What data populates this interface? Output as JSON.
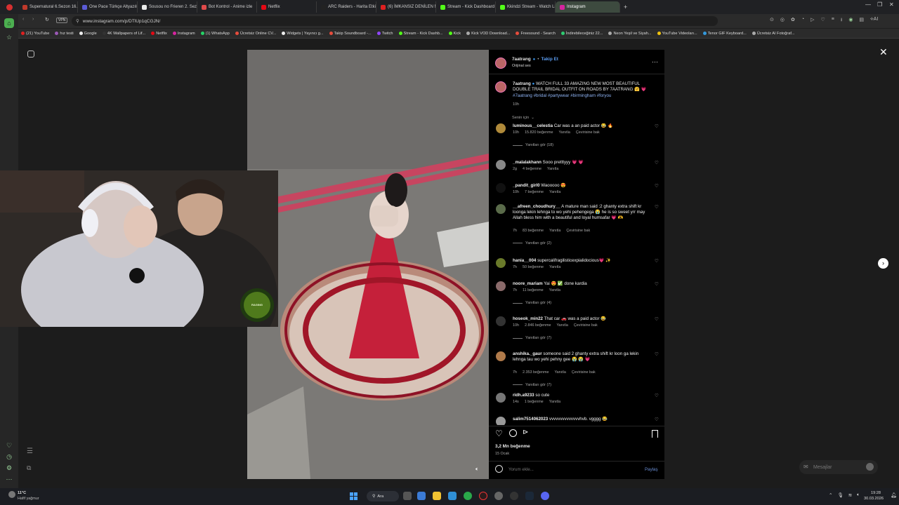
{
  "browser": {
    "tabs": [
      {
        "title": "Supernatural 6.Sezon 16.B",
        "color": "#c0392b"
      },
      {
        "title": "One Pace Türkçe Altyazılı",
        "color": "#5b5bd6"
      },
      {
        "title": "Sousou no Frieren 2. Sezo",
        "color": "#eaeaea"
      },
      {
        "title": "Bot Kontrol - Anime izle",
        "color": "#e04a4a"
      },
      {
        "title": "Netflix",
        "color": "#e50914"
      },
      {
        "title": "ARC Raiders - Harita Etkin",
        "color": "#222"
      },
      {
        "title": "(6) İMKANSIZ DENİLEN M",
        "color": "#e02020"
      },
      {
        "title": "Stream - Kick Dashboard",
        "color": "#53fc18"
      },
      {
        "title": "Kkindzi Stream - Watch Li",
        "color": "#53fc18"
      },
      {
        "title": "Instagram",
        "color": "#d6249f"
      }
    ],
    "url": "www.instagram.com/p/DTlUp1qCGJN/",
    "vpn_label": "VPN",
    "bookmarks": [
      {
        "label": "(21) YouTube",
        "color": "#e02020"
      },
      {
        "label": "hız testi",
        "color": "#9b59b6"
      },
      {
        "label": "Google",
        "color": "#eee"
      },
      {
        "label": "4K Wallpapers of Lif...",
        "color": "#333"
      },
      {
        "label": "Netflix",
        "color": "#e50914"
      },
      {
        "label": "Instagram",
        "color": "#d6249f"
      },
      {
        "label": "(1) WhatsApp",
        "color": "#25d366"
      },
      {
        "label": "Ücretsiz Online CV...",
        "color": "#e74c3c"
      },
      {
        "label": "Widgets | Yayıncı g...",
        "color": "#eee"
      },
      {
        "label": "Takip Soundboard -...",
        "color": "#e74c3c"
      },
      {
        "label": "Twitch",
        "color": "#9146ff"
      },
      {
        "label": "Stream - Kick Dashb...",
        "color": "#53fc18"
      },
      {
        "label": "Kick",
        "color": "#53fc18"
      },
      {
        "label": "Kick VOD Download...",
        "color": "#aaa"
      },
      {
        "label": "Freesound - Search",
        "color": "#e74c3c"
      },
      {
        "label": "İndirebileceğiniz 22...",
        "color": "#2ecc71"
      },
      {
        "label": "Neon Yeşil ve Siyah...",
        "color": "#aaa"
      },
      {
        "label": "YouTube Videoları...",
        "color": "#f1c40f"
      },
      {
        "label": "Tenor GIF Keyboard...",
        "color": "#3498db"
      },
      {
        "label": "Ücretsiz AI Fotoğraf...",
        "color": "#aaa"
      }
    ]
  },
  "post": {
    "author": "7aatrang",
    "follow_label": "Takip Et",
    "audio": "Orijinal ses",
    "caption_user": "7aatrang",
    "caption_text": "WATCH FULL 33 AMAZING NEW MOST BEAUTIFUL DOUBLE TRAIL BRIDAL OUTFIT ON ROADS BY 7AATRANG",
    "caption_tags": "#7aatrang #bridal #partywear #birmingham #foryou",
    "caption_time": "10h",
    "sort_label": "Senin için",
    "likes": "3,2 Mn beğenme",
    "date": "15 Ocak",
    "comment_placeholder": "Yorum ekle...",
    "share_label": "Paylaş"
  },
  "comments": [
    {
      "user": "luminous__celestia",
      "text": "Car was a an paid actor 😂 🔥",
      "meta": [
        "10h",
        "15.820 beğenme",
        "Yanıtla",
        "Çevirisine bak"
      ],
      "replies": "Yanıtları gör (18)",
      "avatar": "#b08a3a"
    },
    {
      "user": "_malalakhann",
      "text": "Sooo pretttyyy 💗 💗",
      "meta": [
        "2g",
        "4 beğenme",
        "Yanıtla"
      ],
      "replies": "",
      "avatar": "#888"
    },
    {
      "user": "_pandit_girl0",
      "text": "Waooooo 😍",
      "meta": [
        "10h",
        "7 beğenme",
        "Yanıtla"
      ],
      "replies": "",
      "avatar": "#111"
    },
    {
      "user": "__afreen_choudhury__",
      "text": "A mature man said :2 ghanty extra shift kr loonga lekin lehnga to wo yehi pehengega 😭 he is so sweet yrr may Allah bless him with a beautiful and loyal humsafar 💗 🫶",
      "meta": [
        "7h",
        "83 beğenme",
        "Yanıtla",
        "Çevirisine bak"
      ],
      "replies": "Yanıtları gör (2)",
      "avatar": "#5a6b4a"
    },
    {
      "user": "hania__004",
      "text": "supercalifragilisticexpialidocious💗 ✨",
      "meta": [
        "7h",
        "50 beğenme",
        "Yanıtla"
      ],
      "replies": "",
      "avatar": "#6a7a2a"
    },
    {
      "user": "noore_mariam",
      "text": "Yai 😍 ✅ done kardia",
      "meta": [
        "7h",
        "11 beğenme",
        "Yanıtla"
      ],
      "replies": "Yanıtları gör (4)",
      "avatar": "#8a6a6a"
    },
    {
      "user": "hoseok_min22",
      "text": "That car 🚗 was a paid actor 😂",
      "meta": [
        "10h",
        "2.846 beğenme",
        "Yanıtla",
        "Çevirisine bak"
      ],
      "replies": "Yanıtları gör (7)",
      "avatar": "#333"
    },
    {
      "user": "anshika._gaur",
      "text": "someone said 2 ghanty extra shift kr loon ga lekin lehnga tau wo yehi pehny gee 😭 😭 💗",
      "meta": [
        "7h",
        "2.353 beğenme",
        "Yanıtla",
        "Çevirisine bak"
      ],
      "replies": "Yanıtları gör (7)",
      "avatar": "#b07a4a"
    },
    {
      "user": "ridh.a9233",
      "text": "so cute",
      "meta": [
        "14s",
        "1 beğenme",
        "Yanıtla"
      ],
      "replies": "",
      "avatar": "#777"
    },
    {
      "user": "salim7514062023",
      "text": "vvvvvvvvvvvvvvhvb. vgggg 😂",
      "meta": [],
      "replies": "",
      "avatar": "#999"
    }
  ],
  "ui": {
    "messages_label": "Mesajlar",
    "weather_temp": "11°C",
    "weather_desc": "Hafif yağmur",
    "search_label": "Ara",
    "clock_time": "19:28",
    "clock_date": "30.03.2026",
    "webcam_badge": "RAGING"
  }
}
